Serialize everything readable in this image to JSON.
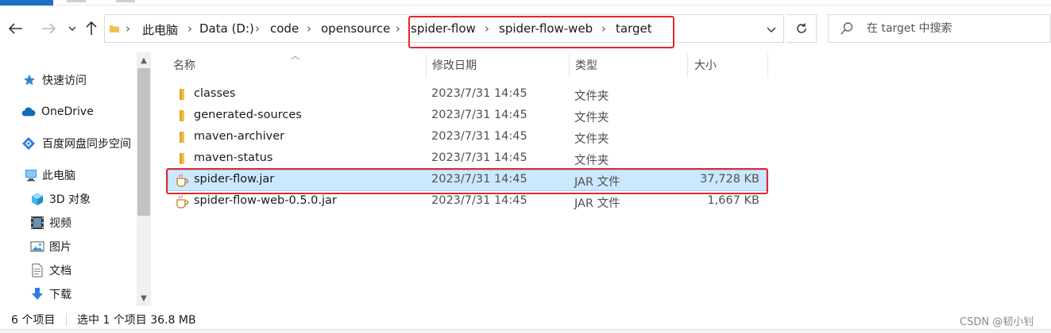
{
  "colors": {
    "accent": "#1f6fc5",
    "selection": "#cce8ff",
    "highlight_box": "#e8252b",
    "folder": "#f2c14e"
  },
  "nav_buttons": {
    "back_icon": "arrow-left-icon",
    "forward_icon": "arrow-right-icon",
    "recent_icon": "chevron-down-icon",
    "up_icon": "arrow-up-icon"
  },
  "address": {
    "crumbs": [
      "此电脑",
      "Data (D:)",
      "code",
      "opensource",
      "spider-flow",
      "spider-flow-web",
      "target"
    ]
  },
  "search": {
    "placeholder": "在 target 中搜索"
  },
  "sidebar": {
    "items": [
      {
        "label": "快速访问",
        "icon": "star-icon"
      },
      {
        "label": "OneDrive",
        "icon": "cloud-icon"
      },
      {
        "label": "百度网盘同步空间",
        "icon": "baidu-netdisk-icon"
      },
      {
        "label": "此电脑",
        "icon": "computer-icon"
      },
      {
        "label": "3D 对象",
        "icon": "cube-icon"
      },
      {
        "label": "视频",
        "icon": "film-icon"
      },
      {
        "label": "图片",
        "icon": "picture-icon"
      },
      {
        "label": "文档",
        "icon": "document-icon"
      },
      {
        "label": "下载",
        "icon": "download-icon"
      }
    ]
  },
  "columns": {
    "name": "名称",
    "modified": "修改日期",
    "type": "类型",
    "size": "大小"
  },
  "files": [
    {
      "name": "classes",
      "modified": "2023/7/31 14:45",
      "type": "文件夹",
      "size": "",
      "icon": "folder-icon"
    },
    {
      "name": "generated-sources",
      "modified": "2023/7/31 14:45",
      "type": "文件夹",
      "size": "",
      "icon": "folder-icon"
    },
    {
      "name": "maven-archiver",
      "modified": "2023/7/31 14:45",
      "type": "文件夹",
      "size": "",
      "icon": "folder-icon"
    },
    {
      "name": "maven-status",
      "modified": "2023/7/31 14:45",
      "type": "文件夹",
      "size": "",
      "icon": "folder-icon"
    },
    {
      "name": "spider-flow.jar",
      "modified": "2023/7/31 14:45",
      "type": "JAR 文件",
      "size": "37,728 KB",
      "icon": "jar-file-icon",
      "selected": true
    },
    {
      "name": "spider-flow-web-0.5.0.jar",
      "modified": "2023/7/31 14:45",
      "type": "JAR 文件",
      "size": "1,667 KB",
      "icon": "jar-file-icon"
    }
  ],
  "status": {
    "item_count": "6 个项目",
    "selection": "选中 1 个项目  36.8 MB"
  },
  "watermark": "CSDN @韧小钊"
}
